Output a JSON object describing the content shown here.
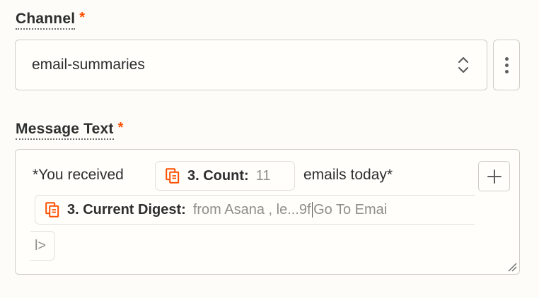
{
  "channel": {
    "label": "Channel",
    "required_mark": "*",
    "value": "email-summaries"
  },
  "message": {
    "label": "Message Text",
    "required_mark": "*",
    "text_before": "*You received",
    "count_pill": {
      "label": "3. Count:",
      "value": "11"
    },
    "text_after": "emails today*",
    "digest_pill": {
      "label": "3. Current Digest:",
      "value_before_cursor": "from Asana , le...9f",
      "value_after_cursor": "Go To Emai",
      "tail_text": "l>"
    }
  },
  "icons": {
    "select": "chevron-updown-icon",
    "more": "more-vertical-icon",
    "doc": "document-icon",
    "add": "plus-icon",
    "resize": "resize-handle-icon"
  },
  "colors": {
    "accent": "#ff4f00",
    "required": "#ff4f00",
    "border": "#cfcdc4"
  }
}
